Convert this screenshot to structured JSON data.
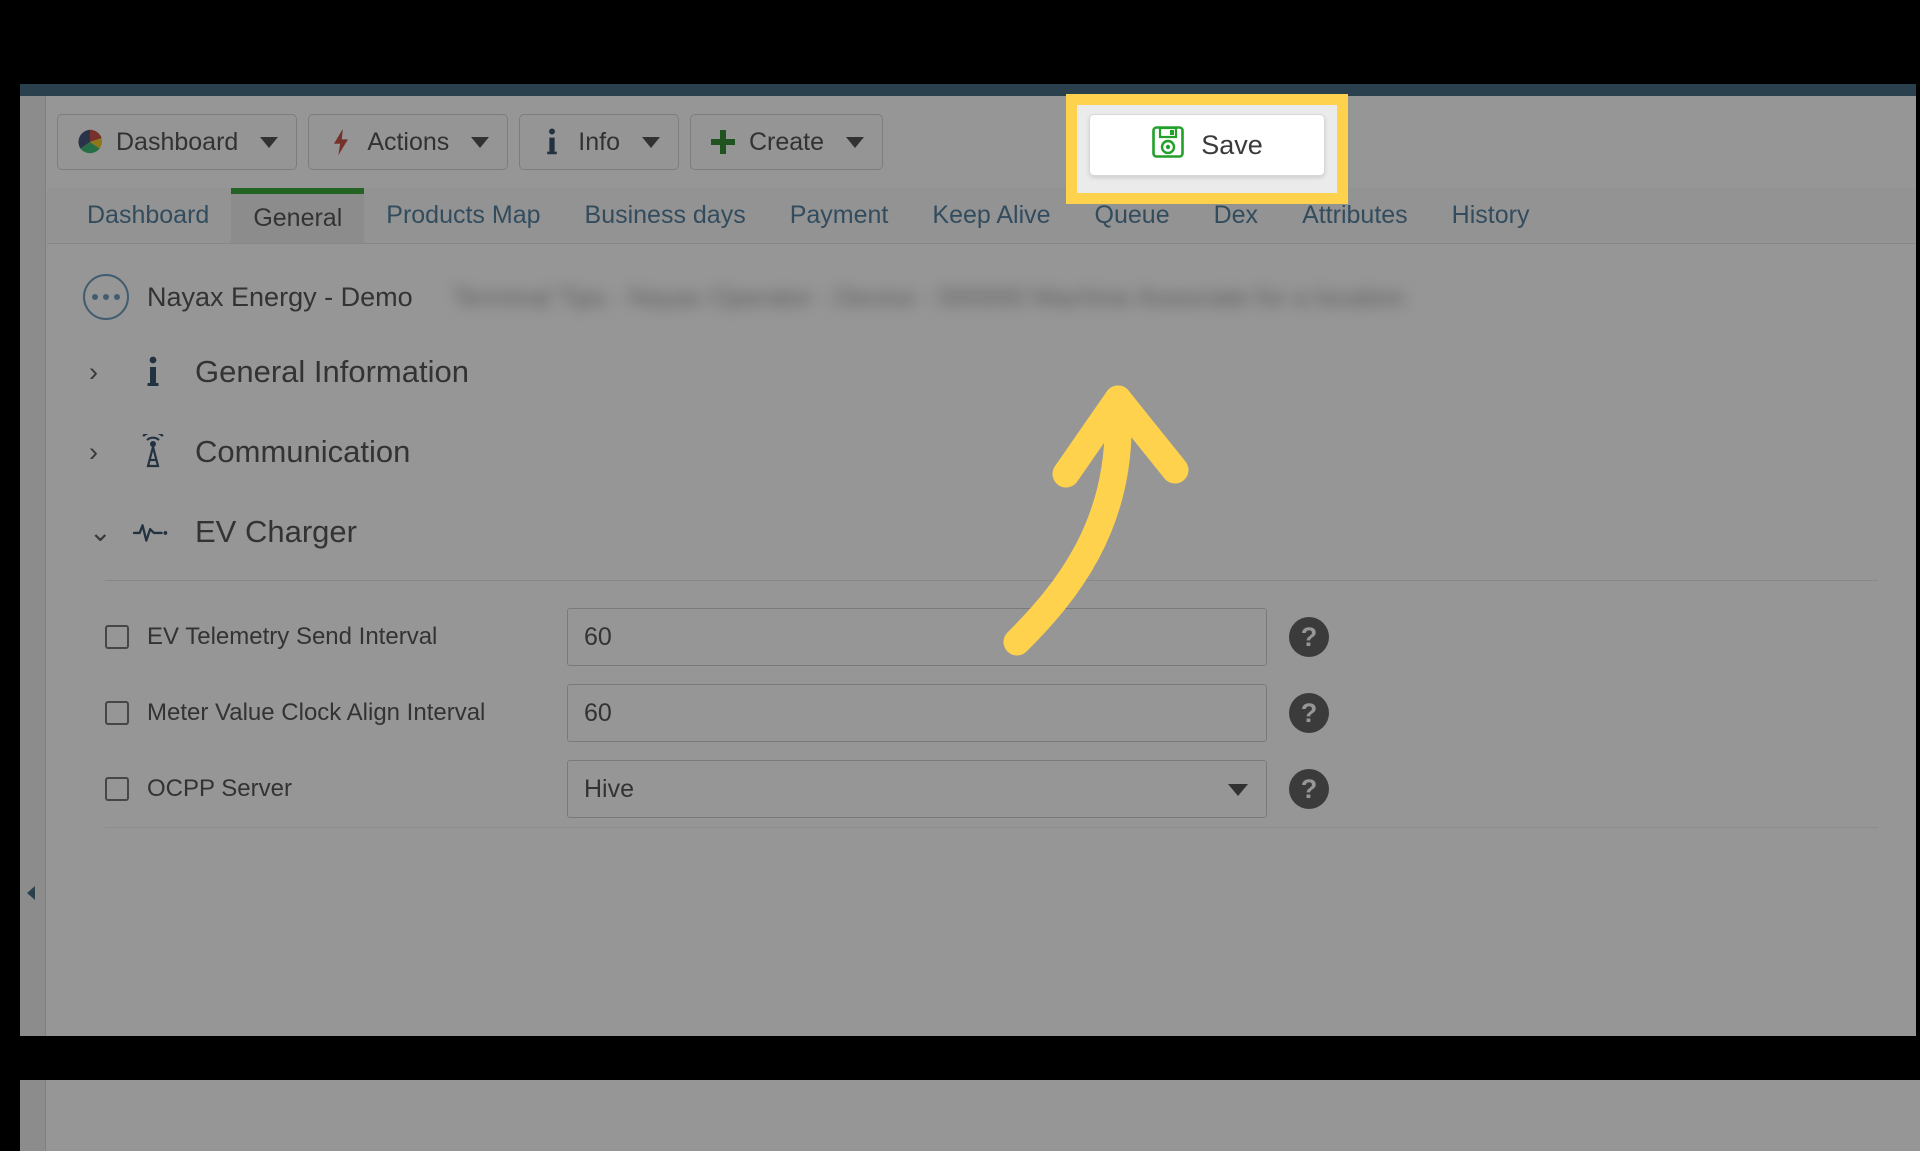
{
  "app": {
    "accent_blue": "#2c5871",
    "tab_link_color": "#3b6f92",
    "active_tab_bar_color": "#1e9b1e",
    "highlight_color": "#ffd24d",
    "dim_overlay": "rgba(40,40,40,0.49)"
  },
  "toolbar": {
    "buttons": [
      {
        "label": "Dashboard",
        "icon": "pie-chart-icon",
        "has_caret": true
      },
      {
        "label": "Actions",
        "icon": "lightning-bolt-icon",
        "has_caret": true
      },
      {
        "label": "Info",
        "icon": "info-icon",
        "has_caret": true
      },
      {
        "label": "Create",
        "icon": "plus-icon",
        "has_caret": true
      }
    ],
    "save": {
      "label": "Save",
      "icon": "floppy-disk-save-icon",
      "highlighted": true
    }
  },
  "tabs": [
    {
      "label": "Dashboard",
      "active": false
    },
    {
      "label": "General",
      "active": true
    },
    {
      "label": "Products Map",
      "active": false
    },
    {
      "label": "Business days",
      "active": false
    },
    {
      "label": "Payment",
      "active": false
    },
    {
      "label": "Keep Alive",
      "active": false
    },
    {
      "label": "Queue",
      "active": false
    },
    {
      "label": "Dex",
      "active": false
    },
    {
      "label": "Attributes",
      "active": false
    },
    {
      "label": "History",
      "active": false
    }
  ],
  "device_header": {
    "menu_icon": "ellipsis-circle-icon",
    "name": "Nayax Energy - Demo",
    "blurred_details": "Terminal Tips - Nayax Operator - Device - 000000 Machine Associate for a location"
  },
  "sections": [
    {
      "label": "General Information",
      "icon": "info-icon",
      "expanded": false,
      "chevron": "chevron-right-icon"
    },
    {
      "label": "Communication",
      "icon": "antenna-icon",
      "expanded": false,
      "chevron": "chevron-right-icon"
    },
    {
      "label": "EV Charger",
      "icon": "pulse-wave-icon",
      "expanded": true,
      "chevron": "chevron-down-icon"
    }
  ],
  "ev_charger_fields": [
    {
      "label": "EV Telemetry Send Interval",
      "type": "text",
      "value": "60",
      "checked": false,
      "help": "?"
    },
    {
      "label": "Meter Value Clock Align Interval",
      "type": "text",
      "value": "60",
      "checked": false,
      "help": "?"
    },
    {
      "label": "OCPP Server",
      "type": "select",
      "value": "Hive",
      "checked": false,
      "help": "?"
    }
  ],
  "annotation": {
    "type": "curved-arrow",
    "color": "#ffd24d",
    "points_to": "Save"
  },
  "sidebar": {
    "collapse_icon": "collapse-left-icon"
  }
}
